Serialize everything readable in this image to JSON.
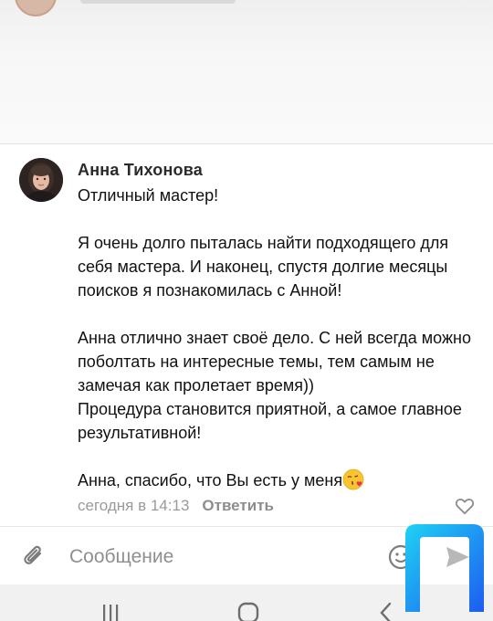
{
  "comment": {
    "author": "Анна Тихонова",
    "text": "Отличный мастер!\n\nЯ очень долго пыталась найти подходящего для себя мастера. И наконец, спустя долгие месяцы поисков я познакомилась с Анной!\n\nАнна отлично знает своё дело. С ней всегда можно поболтать на интересные темы, тем самым не замечая как пролетает время))\nПроцедура становится приятной, а самое главное результативной!\n\nАнна, спасибо, что Вы есть у меня",
    "emoji": "face-blowing-a-kiss",
    "timestamp": "сегодня в 14:13",
    "reply_label": "Ответить"
  },
  "composer": {
    "placeholder": "Сообщение"
  },
  "icons": {
    "like": "heart-outline-icon",
    "attach": "paperclip-icon",
    "emoji": "smiley-icon",
    "send": "send-arrow-icon"
  },
  "colors": {
    "meta_text": "#9a9a9a",
    "watermark_blue": "#1d5cf0",
    "watermark_cyan": "#1fd2f4"
  }
}
